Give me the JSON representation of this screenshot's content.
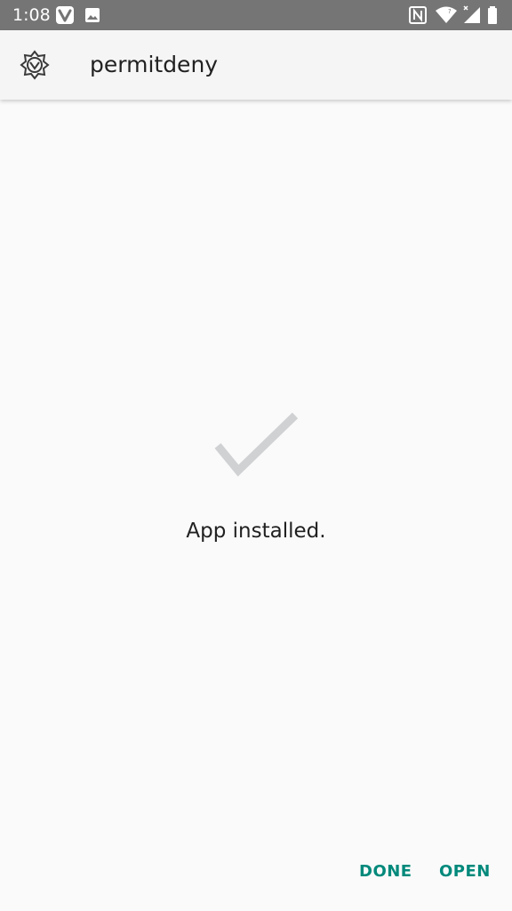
{
  "status_bar": {
    "time": "1:08",
    "background": "#757575",
    "left_icons": [
      "vivaldi-icon",
      "image-icon"
    ],
    "right_icons": [
      "nfc-icon",
      "wifi-icon",
      "signal-icon",
      "battery-icon"
    ]
  },
  "app_bar": {
    "title": "permitdeny",
    "logo_icon": "app-logo-icon"
  },
  "content": {
    "status_icon": "checkmark-icon",
    "message": "App installed."
  },
  "buttons": {
    "done_label": "DONE",
    "open_label": "OPEN",
    "accent": "#00897b"
  },
  "colors": {
    "background": "#fafafa",
    "app_bar_bg": "#f5f5f5",
    "text_primary": "#212121",
    "checkmark": "#cfd1d3"
  }
}
